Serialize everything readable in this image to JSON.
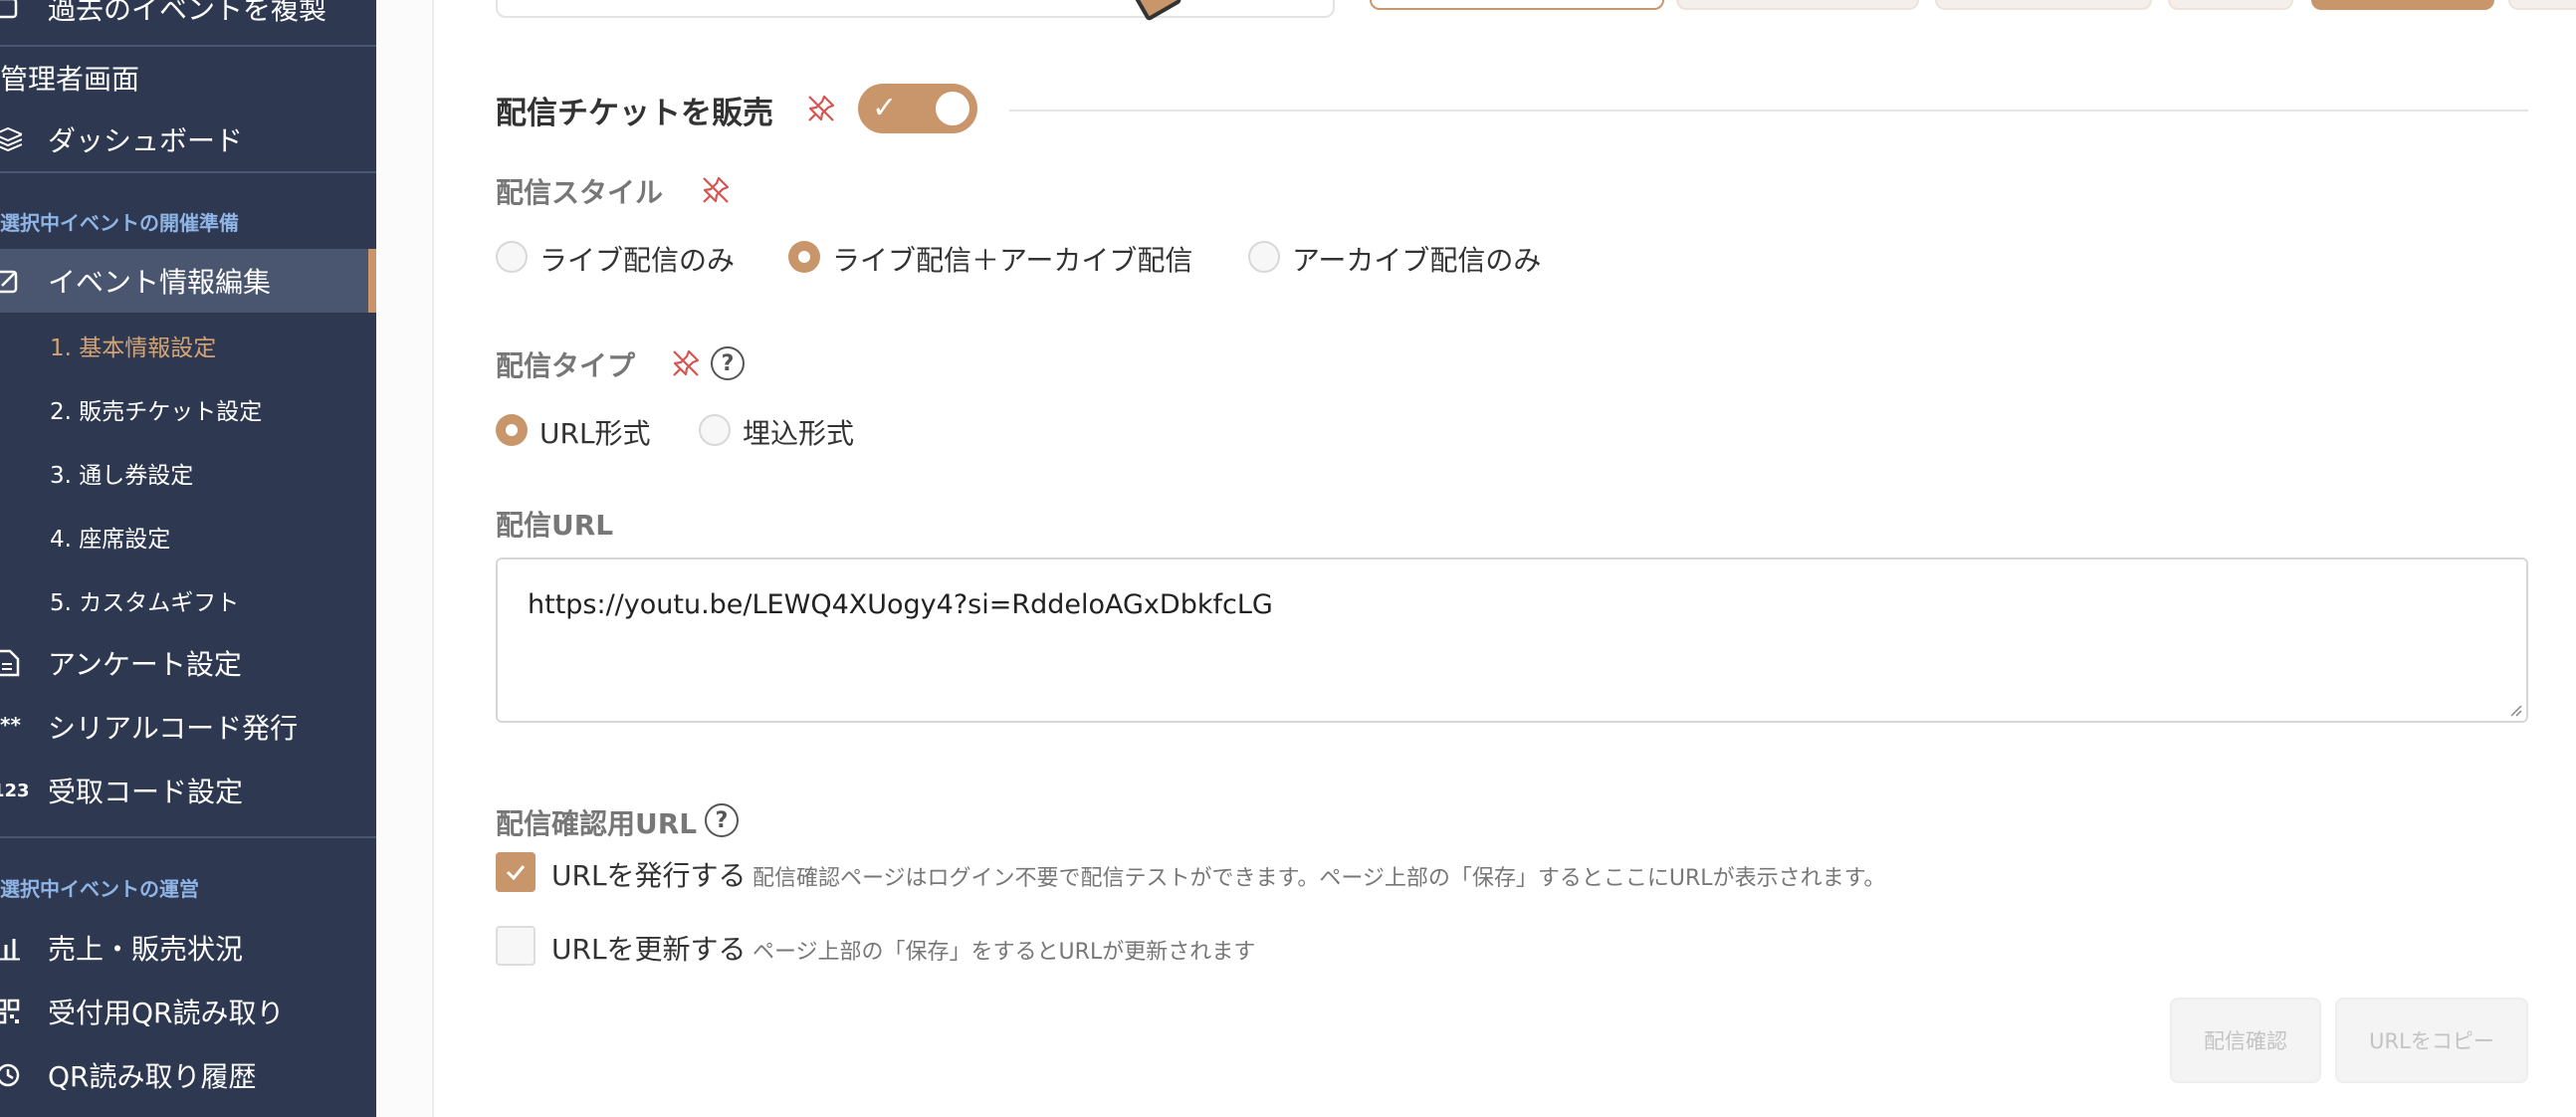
{
  "sidebar": {
    "copy_event": "過去のイベントを複製",
    "admin_header": "管理者画面",
    "dashboard": "ダッシュボード",
    "prep_header": "選択中イベントの開催準備",
    "event_edit": "イベント情報編集",
    "sub_items": [
      "1. 基本情報設定",
      "2. 販売チケット設定",
      "3. 通し券設定",
      "4. 座席設定",
      "5. カスタムギフト"
    ],
    "survey": "アンケート設定",
    "serial_icon_text": "**",
    "serial": "シリアルコード発行",
    "receive_icon_text": "123",
    "receive": "受取コード設定",
    "ops_header": "選択中イベントの運営",
    "sales": "売上・販売状況",
    "qr_read": "受付用QR読み取り",
    "qr_history": "QR読み取り履歴"
  },
  "section": {
    "title": "配信チケットを販売",
    "toggle_on": true,
    "toggle_check": "✓"
  },
  "style_field": {
    "label": "配信スタイル",
    "options": [
      "ライブ配信のみ",
      "ライブ配信＋アーカイブ配信",
      "アーカイブ配信のみ"
    ],
    "selected": 1
  },
  "type_field": {
    "label": "配信タイプ",
    "help": "?",
    "options": [
      "URL形式",
      "埋込形式"
    ],
    "selected": 0
  },
  "url_field": {
    "label": "配信URL",
    "value": "https://youtu.be/LEWQ4XUogy4?si=RddeloAGxDbkfcLG"
  },
  "confirm_field": {
    "label": "配信確認用URL",
    "help": "?",
    "issue_label": "URLを発行する",
    "issue_note": "配信確認ページはログイン不要で配信テストができます。ページ上部の「保存」するとここにURLが表示されます。",
    "issue_checked": true,
    "update_label": "URLを更新する",
    "update_note": "ページ上部の「保存」をするとURLが更新されます",
    "update_checked": false
  },
  "buttons": {
    "confirm": "配信確認",
    "copy": "URLをコピー"
  },
  "colors": {
    "accent": "#c8966a",
    "sidebar": "#2e3951",
    "section_header": "#8fb4e6",
    "pin": "#d9534f"
  }
}
